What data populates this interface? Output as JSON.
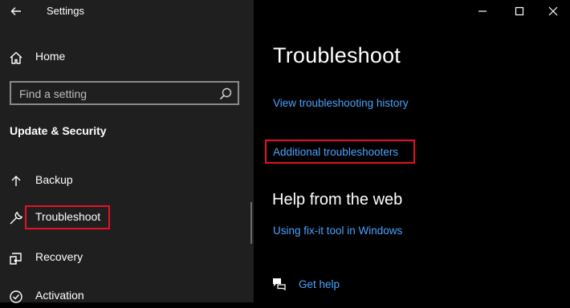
{
  "app": {
    "title": "Settings"
  },
  "sidebar": {
    "home_label": "Home",
    "search": {
      "placeholder": "Find a setting"
    },
    "section_title": "Update & Security",
    "items": [
      {
        "label": "Backup",
        "icon": "backup-icon"
      },
      {
        "label": "Troubleshoot",
        "icon": "wrench-icon",
        "selected": true
      },
      {
        "label": "Recovery",
        "icon": "recovery-icon"
      },
      {
        "label": "Activation",
        "icon": "activation-icon"
      }
    ]
  },
  "main": {
    "title": "Troubleshoot",
    "links": {
      "history": "View troubleshooting history",
      "additional": "Additional troubleshooters"
    },
    "help": {
      "title": "Help from the web",
      "link": "Using fix-it tool in Windows",
      "get_help": "Get help"
    }
  },
  "colors": {
    "link": "#4aa3ff",
    "highlight": "#e81123",
    "sidebar_bg": "#1f1f1f",
    "main_bg": "#000000"
  }
}
